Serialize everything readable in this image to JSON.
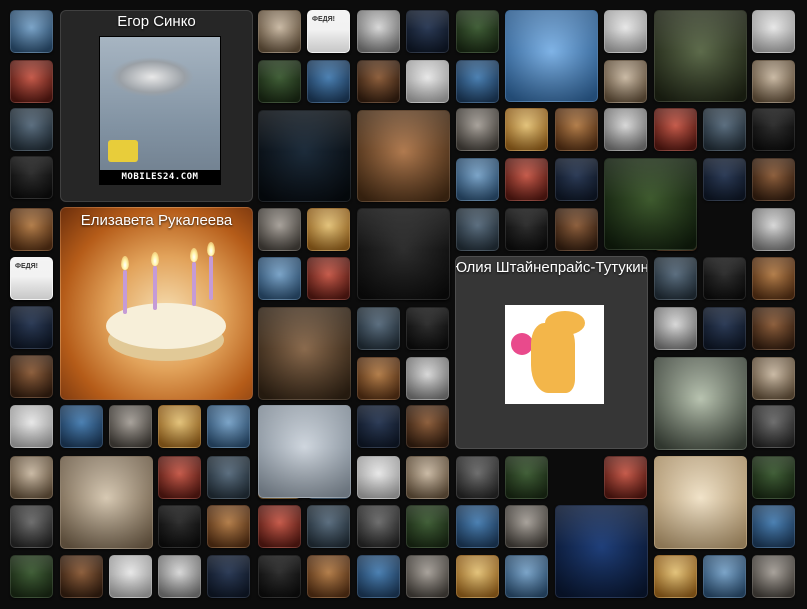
{
  "profiles": [
    {
      "name": "Егор Синко",
      "photo_caption": "MOBILES24.COM"
    },
    {
      "name": "Елизавета Рукалеева"
    },
    {
      "name": "Юлия Штайнепрайс-Тутукина"
    }
  ],
  "thumbnail_captions": {
    "fedya_tile_text": "ФЕДЯ!"
  },
  "colors": {
    "background": "#0c0c0c",
    "card": "#262626"
  }
}
